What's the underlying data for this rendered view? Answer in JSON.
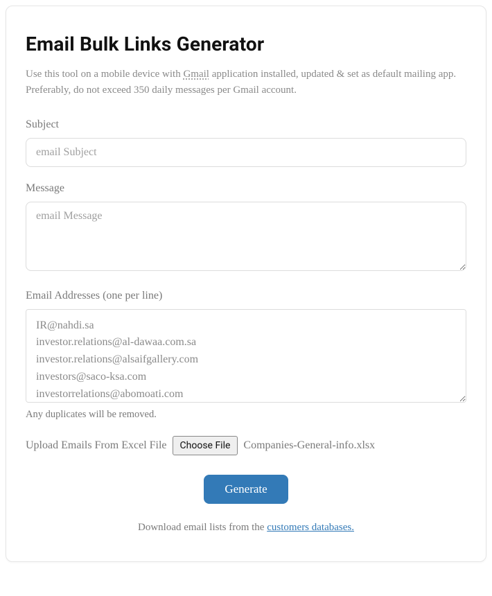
{
  "title": "Email Bulk Links Generator",
  "intro": {
    "before": "Use this tool on a mobile device with ",
    "gmail": "Gmail",
    "after": " application installed, updated & set as default mailing app. Preferably, do not exceed 350 daily messages per Gmail account."
  },
  "subject": {
    "label": "Subject",
    "placeholder": "email Subject",
    "value": ""
  },
  "message": {
    "label": "Message",
    "placeholder": "email Message",
    "value": ""
  },
  "emails": {
    "label": "Email Addresses (one per line)",
    "value": "IR@nahdi.sa\ninvestor.relations@al-dawaa.com.sa\ninvestor.relations@alsaifgallery.com\ninvestors@saco-ksa.com\ninvestorrelations@abomoati.com",
    "hint": "Any duplicates will be removed."
  },
  "upload": {
    "label": "Upload Emails From Excel File",
    "button": "Choose File",
    "filename": "Companies-General-info.xlsx"
  },
  "generate": "Generate",
  "footer": {
    "before": "Download email lists from the ",
    "link": "customers databases."
  }
}
